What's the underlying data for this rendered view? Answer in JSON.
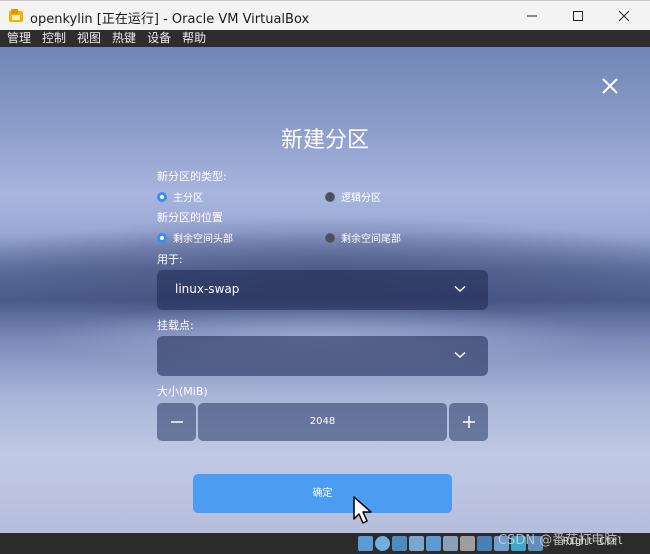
{
  "window": {
    "title": "openkylin [正在运行] - Oracle VM VirtualBox"
  },
  "menubar": {
    "items": [
      "管理",
      "控制",
      "视图",
      "热键",
      "设备",
      "帮助"
    ]
  },
  "dialog": {
    "title": "新建分区",
    "type_label": "新分区的类型:",
    "type_options": [
      {
        "label": "主分区",
        "selected": true
      },
      {
        "label": "逻辑分区",
        "selected": false
      }
    ],
    "position_label": "新分区的位置",
    "position_options": [
      {
        "label": "剩余空间头部",
        "selected": true
      },
      {
        "label": "剩余空间尾部",
        "selected": false
      }
    ],
    "use_label": "用于:",
    "use_value": "linux-swap",
    "mount_label": "挂载点:",
    "mount_value": "",
    "size_label": "大小(MiB)",
    "size_value": "2048",
    "minus_symbol": "−",
    "plus_symbol": "+",
    "confirm_label": "确定"
  },
  "statusbar": {
    "hostkey": "Right Ctrl",
    "watermark": "CSDN @番茄打电脑"
  },
  "colors": {
    "accent": "#4c9cf2",
    "radio_selected": "#3b8ef0"
  }
}
